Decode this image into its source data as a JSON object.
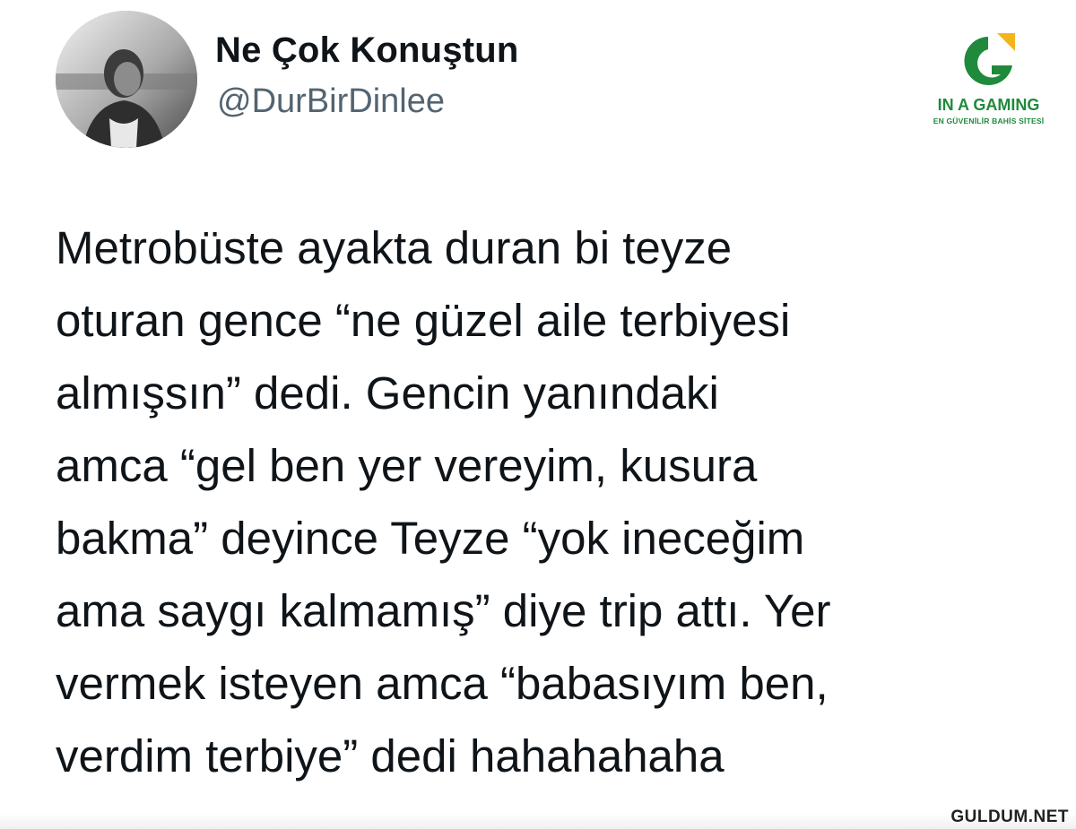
{
  "tweet": {
    "display_name": "Ne Çok Konuştun",
    "handle": "@DurBirDinlee",
    "avatar_icon": "profile-photo",
    "lines": [
      "Metrobüste ayakta duran bi teyze",
      "oturan gence “ne güzel aile terbiyesi",
      "almışsın” dedi. Gencin yanındaki",
      "amca “gel ben yer vereyim, kusura",
      "bakma” deyince Teyze “yok ineceğim",
      "ama saygı kalmamış” diye trip attı. Yer",
      "vermek isteyen amca “babasıyım ben,",
      "verdim terbiye” dedi hahahahaha"
    ]
  },
  "watermark_logo": {
    "title": "IN A GAMING",
    "subtitle": "EN GÜVENİLİR BAHİS SİTESİ",
    "icon": "g-logo-icon",
    "colors": {
      "green": "#1f8a3b",
      "yellow": "#f2b51c"
    }
  },
  "site_watermark": "GULDUM.NET",
  "colors": {
    "text_primary": "#0f1419",
    "text_secondary": "#536471"
  }
}
